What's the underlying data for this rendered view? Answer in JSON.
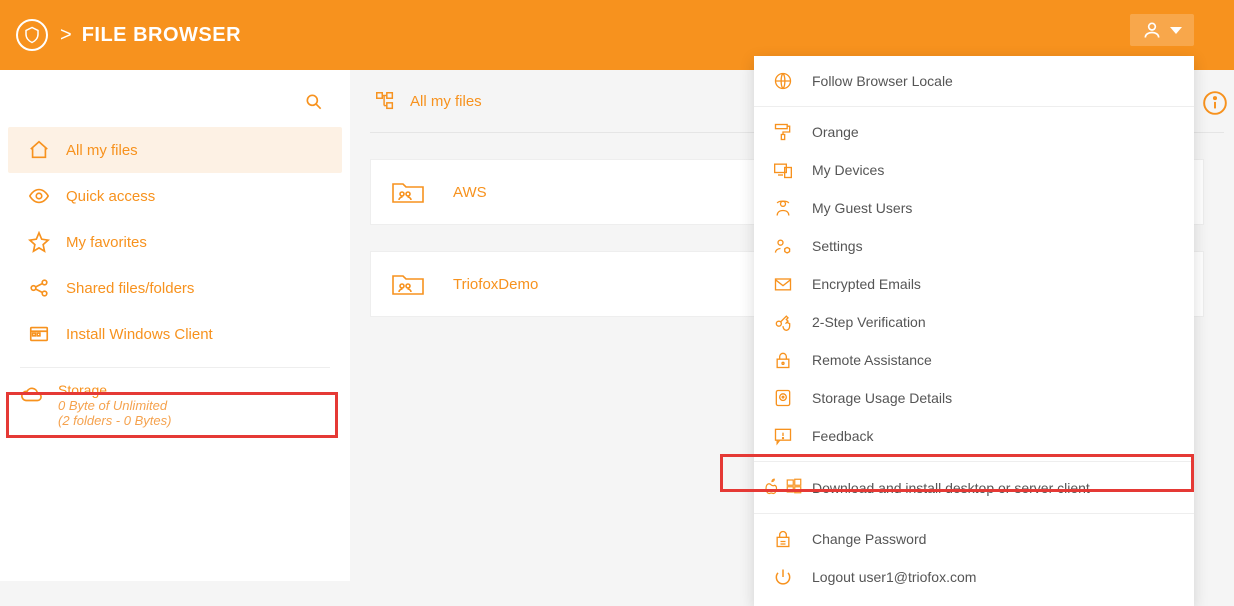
{
  "colors": {
    "accent": "#f7921e",
    "highlight": "#e53935"
  },
  "header": {
    "title": "FILE BROWSER",
    "sep": ">"
  },
  "sidebar": {
    "items": [
      {
        "label": "All my files"
      },
      {
        "label": "Quick access"
      },
      {
        "label": "My favorites"
      },
      {
        "label": "Shared files/folders"
      },
      {
        "label": "Install Windows Client"
      }
    ],
    "storage": {
      "title": "Storage",
      "line1": "0 Byte of Unlimited",
      "line2": "(2 folders - 0 Bytes)"
    }
  },
  "content": {
    "breadcrumb": "All my files",
    "files": [
      {
        "name": "AWS"
      },
      {
        "name": "TriofoxDemo"
      }
    ]
  },
  "dropdown": {
    "items": [
      {
        "label": "Follow Browser Locale"
      },
      {
        "label": "Orange"
      },
      {
        "label": "My Devices"
      },
      {
        "label": "My Guest Users"
      },
      {
        "label": "Settings"
      },
      {
        "label": "Encrypted Emails"
      },
      {
        "label": "2-Step Verification"
      },
      {
        "label": "Remote Assistance"
      },
      {
        "label": "Storage Usage Details"
      },
      {
        "label": "Feedback"
      },
      {
        "label": "Download and install desktop or server client"
      },
      {
        "label": "Change Password"
      },
      {
        "label": "Logout user1@triofox.com"
      }
    ]
  }
}
